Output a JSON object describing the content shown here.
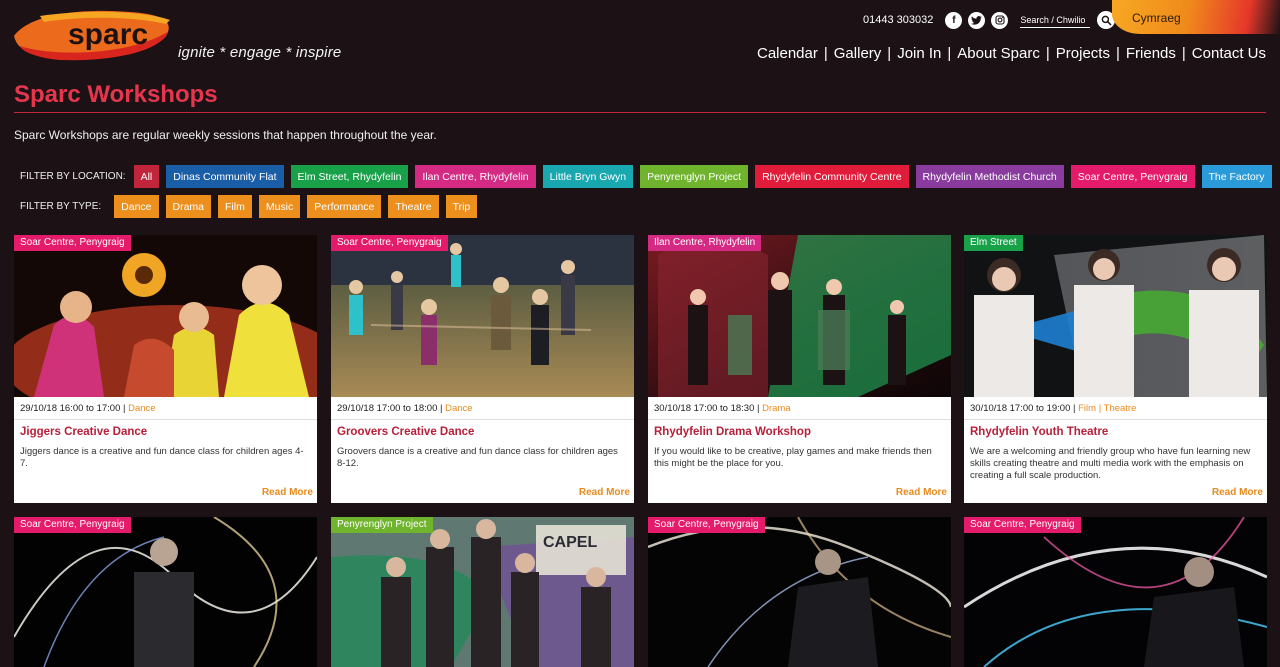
{
  "site": {
    "logo_text": "sparc",
    "tagline": "ignite * engage * inspire",
    "phone": "01443 303032",
    "search_placeholder": "Search / Chwilio",
    "language_label": "Cymraeg",
    "nav": [
      "Calendar",
      "Gallery",
      "Join In",
      "About Sparc",
      "Projects",
      "Friends",
      "Contact Us"
    ],
    "social_icons": [
      "facebook-icon",
      "twitter-icon",
      "instagram-icon"
    ]
  },
  "page": {
    "title": "Sparc Workshops",
    "intro": "Sparc Workshops are regular weekly sessions that happen throughout the year."
  },
  "filters": {
    "location_label": "FILTER BY LOCATION:",
    "locations": [
      {
        "label": "All",
        "color": "#c0253b"
      },
      {
        "label": "Dinas Community Flat",
        "color": "#1a5ea8"
      },
      {
        "label": "Elm Street, Rhydyfelin",
        "color": "#19a14a"
      },
      {
        "label": "Ilan Centre, Rhydyfelin",
        "color": "#d42a84"
      },
      {
        "label": "Little Bryn Gwyn",
        "color": "#1aa8b0"
      },
      {
        "label": "Penyrenglyn Project",
        "color": "#6fb42c"
      },
      {
        "label": "Rhydyfelin Community Centre",
        "color": "#e11c3a"
      },
      {
        "label": "Rhydyfelin Methodist Church",
        "color": "#8a3c9e"
      },
      {
        "label": "Soar Centre, Penygraig",
        "color": "#e41b6a"
      },
      {
        "label": "The Factory",
        "color": "#2a9ad8"
      }
    ],
    "type_label": "FILTER BY TYPE:",
    "types": [
      "Dance",
      "Drama",
      "Film",
      "Music",
      "Performance",
      "Theatre",
      "Trip"
    ],
    "type_color": "#ec8f1d"
  },
  "cards": [
    {
      "location": "Soar Centre, Penygraig",
      "location_color": "#e41b6a",
      "datetime": "29/10/18 16:00 to 17:00",
      "types": "Dance",
      "title": "Jiggers Creative Dance",
      "description": "Jiggers dance is a creative and fun dance class for children ages 4-7.",
      "more": "Read More"
    },
    {
      "location": "Soar Centre, Penygraig",
      "location_color": "#e41b6a",
      "datetime": "29/10/18 17:00 to 18:00",
      "types": "Dance",
      "title": "Groovers Creative Dance",
      "description": "Groovers dance is a creative and fun dance class for children ages 8-12.",
      "more": "Read More"
    },
    {
      "location": "Ilan Centre, Rhydyfelin",
      "location_color": "#d42a84",
      "datetime": "30/10/18 17:00 to 18:30",
      "types": "Drama",
      "title": "Rhydyfelin Drama Workshop",
      "description": "If you would like to be creative, play games and make friends then this might be the place for you.",
      "more": "Read More"
    },
    {
      "location": "Elm Street",
      "location_color": "#19a14a",
      "datetime": "30/10/18 17:00 to 19:00",
      "types": "Film | Theatre",
      "title": "Rhydyfelin Youth Theatre",
      "description": "We are a welcoming and friendly group who have fun learning new skills creating theatre and multi media work with the emphasis on creating a full scale production.",
      "more": "Read More"
    }
  ],
  "cards_row2": [
    {
      "location": "Soar Centre, Penygraig",
      "location_color": "#e41b6a"
    },
    {
      "location": "Penyrenglyn Project",
      "location_color": "#6fb42c"
    },
    {
      "location": "Soar Centre, Penygraig",
      "location_color": "#e41b6a"
    },
    {
      "location": "Soar Centre, Penygraig",
      "location_color": "#e41b6a"
    }
  ],
  "photo_sign_text": "CAPEL"
}
